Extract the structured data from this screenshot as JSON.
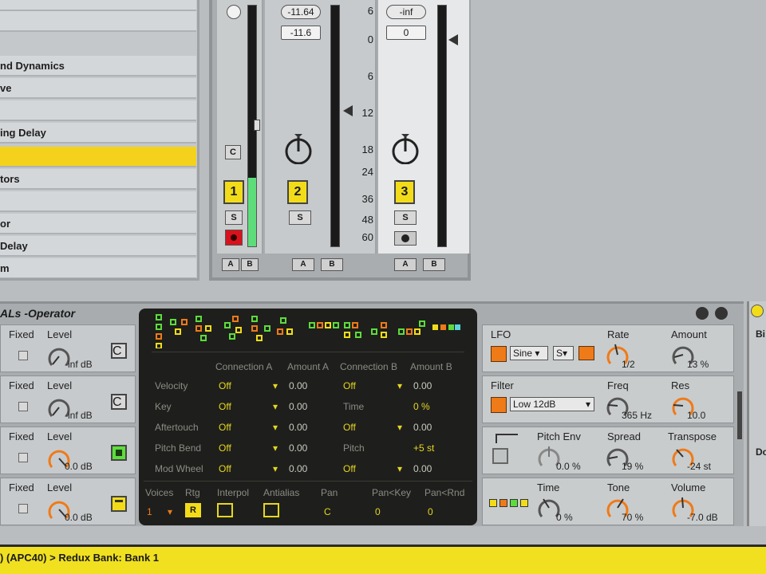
{
  "browser": {
    "items": [
      {
        "label": "",
        "selected": false
      },
      {
        "label": "",
        "selected": false
      },
      {
        "label": "nd Dynamics",
        "selected": false
      },
      {
        "label": "ve",
        "selected": false
      },
      {
        "label": "",
        "selected": false
      },
      {
        "label": "ing Delay",
        "selected": false
      },
      {
        "label": "",
        "selected": true
      },
      {
        "label": "tors",
        "selected": false
      },
      {
        "label": "",
        "selected": false
      },
      {
        "label": "or",
        "selected": false
      },
      {
        "label": "Delay",
        "selected": false
      },
      {
        "label": "m",
        "selected": false
      }
    ]
  },
  "mixer": {
    "master": {
      "track_label": "1",
      "solo": "S",
      "crossfade_a": "A",
      "crossfade_b": "B",
      "c_btn": "C"
    },
    "track2": {
      "peak": "-11.64",
      "volume": "-11.6",
      "number": "2",
      "solo": "S",
      "crossfade_a": "A",
      "crossfade_b": "B"
    },
    "track3": {
      "peak": "-inf",
      "volume": "0",
      "number": "3",
      "solo": "S",
      "crossfade_a": "A",
      "crossfade_b": "B"
    },
    "db_scale": [
      "6",
      "0",
      "6",
      "12",
      "18",
      "24",
      "36",
      "48",
      "60"
    ],
    "colors": {
      "track_yellow": "#f2dc1a",
      "meter_green": "#5ddc7a",
      "record_red": "#d8121c"
    }
  },
  "device": {
    "title": "ALs -Operator",
    "operators": [
      {
        "fixed": "Fixed",
        "level_label": "Level",
        "level": "-inf dB",
        "btn": "C"
      },
      {
        "fixed": "Fixed",
        "level_label": "Level",
        "level": "-inf dB",
        "btn": "C"
      },
      {
        "fixed": "Fixed",
        "level_label": "Level",
        "level": "0.0 dB",
        "btn": ""
      },
      {
        "fixed": "Fixed",
        "level_label": "Level",
        "level": "0.0 dB",
        "btn": ""
      }
    ],
    "matrix": {
      "headers": [
        "Connection A",
        "Amount A",
        "Connection B",
        "Amount B"
      ],
      "rows": [
        {
          "source": "Velocity",
          "conn_a": "Off",
          "amt_a": "0.00",
          "conn_b": "Off",
          "amt_b": "0.00"
        },
        {
          "source": "Key",
          "conn_a": "Off",
          "amt_a": "0.00",
          "conn_b": "Time",
          "amt_b": "0 %"
        },
        {
          "source": "Aftertouch",
          "conn_a": "Off",
          "amt_a": "0.00",
          "conn_b": "Off",
          "amt_b": "0.00"
        },
        {
          "source": "Pitch Bend",
          "conn_a": "Off",
          "amt_a": "0.00",
          "conn_b": "Pitch",
          "amt_b": "+5 st"
        },
        {
          "source": "Mod Wheel",
          "conn_a": "Off",
          "amt_a": "0.00",
          "conn_b": "Off",
          "amt_b": "0.00"
        }
      ],
      "bottom_labels": [
        "Voices",
        "Rtg",
        "Interpol",
        "Antialias",
        "Pan",
        "Pan<Key",
        "Pan<Rnd"
      ],
      "bottom_values": {
        "voices": "1",
        "rtg": "R",
        "pan": "C",
        "pan_key": "0",
        "pan_rnd": "0"
      }
    },
    "lfo": {
      "label": "LFO",
      "wave": "Sine",
      "mode": "S",
      "rate_label": "Rate",
      "rate": "1/2",
      "amount_label": "Amount",
      "amount": "13 %"
    },
    "filter": {
      "label": "Filter",
      "type": "Low 12dB",
      "freq_label": "Freq",
      "freq": "365 Hz",
      "res_label": "Res",
      "res": "10.0"
    },
    "pitch": {
      "env_label": "Pitch Env",
      "env": "0.0 %",
      "spread_label": "Spread",
      "spread": "19 %",
      "transpose_label": "Transpose",
      "transpose": "-24 st"
    },
    "global": {
      "time_label": "Time",
      "time": "0 %",
      "tone_label": "Tone",
      "tone": "70 %",
      "volume_label": "Volume",
      "volume": "-7.0 dB"
    },
    "right_edge": {
      "label1": "Bi",
      "label2": "Do"
    }
  },
  "status": {
    "text": ") (APC40) > Redux Bank: Bank 1"
  }
}
